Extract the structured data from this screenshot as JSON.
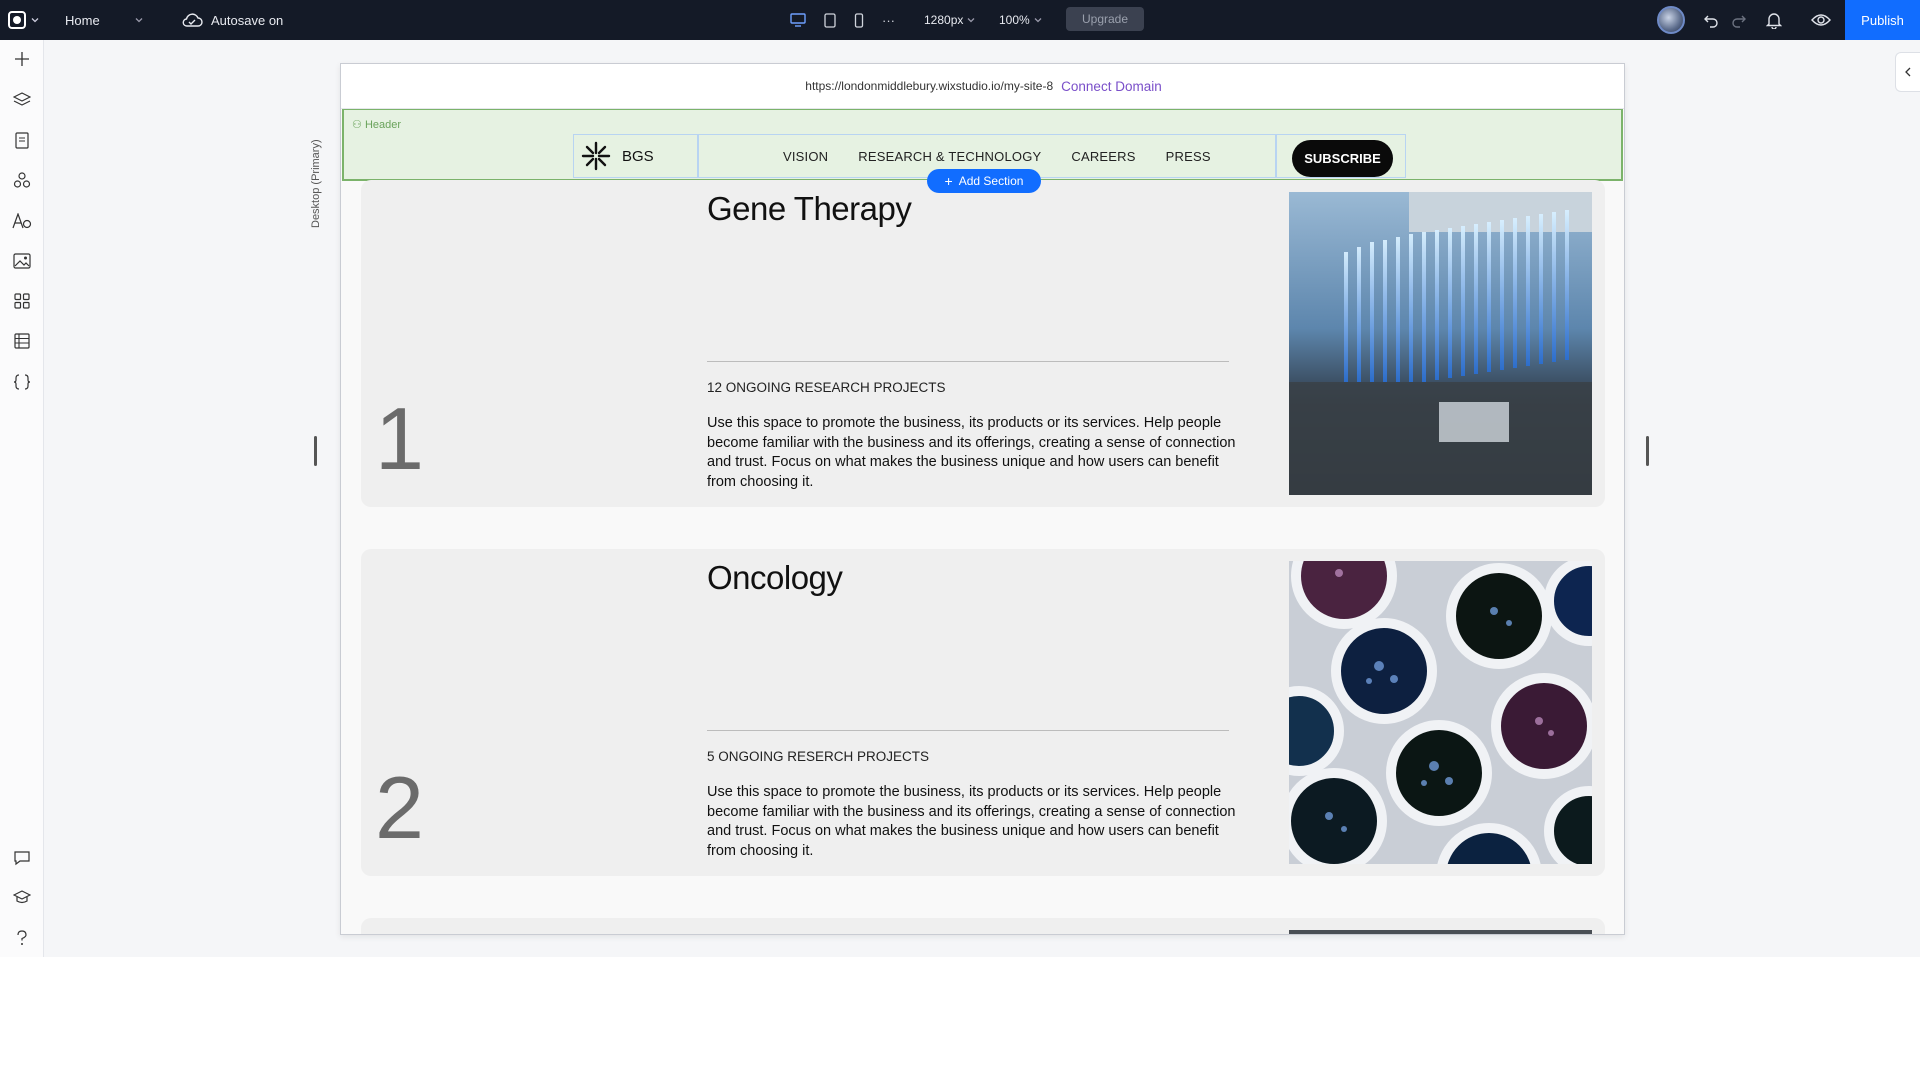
{
  "topbar": {
    "page_name": "Home",
    "autosave": "Autosave on",
    "breakpoint": "1280px",
    "zoom": "100%",
    "more": "···",
    "upgrade": "Upgrade",
    "publish": "Publish"
  },
  "site": {
    "url": "https://londonmiddlebury.wixstudio.io/my-site-8",
    "connect_domain": "Connect Domain",
    "breakpoint_label": "Desktop (Primary)",
    "header_tag": "Header",
    "add_section": "Add Section",
    "brand": "BGS",
    "nav": [
      "VISION",
      "RESEARCH & TECHNOLOGY",
      "CAREERS",
      "PRESS"
    ],
    "subscribe": "SUBSCRIBE"
  },
  "cards": [
    {
      "number": "1",
      "title": "Gene Therapy",
      "projects": "12 ONGOING RESEARCH PROJECTS",
      "description": "Use this space to promote the business, its products or its services. Help people become familiar with the business and its offerings, creating a sense of connection and trust. Focus on what makes the business unique and how users can benefit from choosing it."
    },
    {
      "number": "2",
      "title": "Oncology",
      "projects": "5 ONGOING RESERCH PROJECTS",
      "description": "Use this space to promote the business, its products or its services. Help people become familiar with the business and its offerings, creating a sense of connection and trust. Focus on what makes the business unique and how users can benefit from choosing it."
    }
  ],
  "icons": {
    "sidebar": [
      "add-icon",
      "layers-icon",
      "pages-icon",
      "components-icon",
      "text-theme-icon",
      "media-icon",
      "apps-icon",
      "cms-icon",
      "code-icon",
      "comments-icon",
      "academy-icon",
      "help-icon"
    ],
    "topbar": [
      "logo-icon",
      "chevron-down-icon",
      "cloud-icon",
      "desktop-icon",
      "tablet-icon",
      "mobile-icon",
      "undo-icon",
      "redo-icon",
      "bell-icon",
      "preview-icon"
    ]
  },
  "colors": {
    "topbar_bg": "#141a27",
    "accent_blue": "#116dff",
    "header_green": "#e6f2e2",
    "connect_domain": "#7a4fc9"
  }
}
